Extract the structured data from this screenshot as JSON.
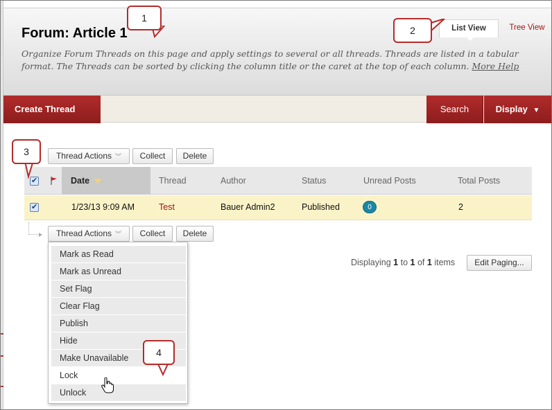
{
  "page": {
    "title": "Forum: Article 1",
    "instructions": "Organize Forum Threads on this page and apply settings to several or all threads. Threads are listed in a tabular format. The Threads can be sorted by clicking the column title or the caret at the top of each column.",
    "more_help": "More Help"
  },
  "view_tabs": {
    "list_view": "List View",
    "tree_view": "Tree View"
  },
  "action_bar": {
    "create_thread": "Create Thread",
    "search": "Search",
    "display": "Display",
    "display_chevron": "⌄"
  },
  "toolbar": {
    "thread_actions": "Thread Actions",
    "collect": "Collect",
    "delete": "Delete",
    "dropdown_glyph": "︾"
  },
  "table": {
    "columns": [
      "Date",
      "Thread",
      "Author",
      "Status",
      "Unread Posts",
      "Total Posts"
    ],
    "rows": [
      {
        "date": "1/23/13 9:09 AM",
        "thread": "Test",
        "author": "Bauer Admin2",
        "status": "Published",
        "unread_posts": "0",
        "total_posts": "2",
        "checked": true
      }
    ]
  },
  "thread_actions_menu": [
    "Mark as Read",
    "Mark as Unread",
    "Set Flag",
    "Clear Flag",
    "Publish",
    "Hide",
    "Make Unavailable",
    "Lock",
    "Unlock"
  ],
  "paging": {
    "prefix": "Displaying",
    "from": "1",
    "to_word": "to",
    "to": "1",
    "of_word": "of",
    "total": "1",
    "suffix": "items",
    "edit_paging": "Edit Paging..."
  },
  "callouts": [
    "1",
    "2",
    "3",
    "4"
  ],
  "colors": {
    "brand_red": "#a01515",
    "action_bar_bg": "#f1ede4",
    "selected_row": "#fbf3c8",
    "badge": "#1b87a6",
    "callout_border": "#b52a2a"
  },
  "icons": {
    "flag": "flag-icon",
    "sort": "sort-caret-icon",
    "cursor": "hand-cursor-icon",
    "checkbox": "checkbox-icon"
  }
}
